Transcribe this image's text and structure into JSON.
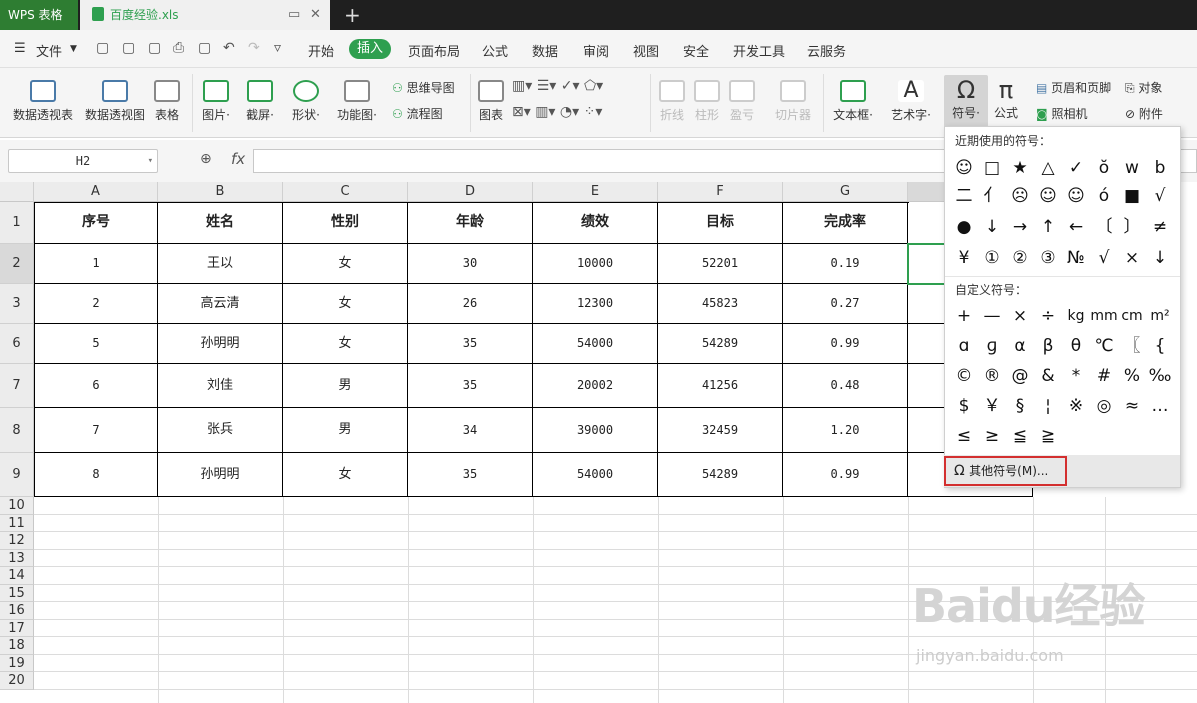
{
  "titlebar": {
    "app": "WPS 表格",
    "file": "百度经验.xls",
    "new_tab": "+"
  },
  "menu": {
    "quick": [
      "▢",
      "▢",
      "▢",
      "⎙",
      "▢",
      "↶",
      "↷",
      "▿"
    ],
    "items": [
      "开始",
      "插入",
      "页面布局",
      "公式",
      "数据",
      "审阅",
      "视图",
      "安全",
      "开发工具",
      "云服务"
    ],
    "file": "文件",
    "active": "插入"
  },
  "ribbon": {
    "big": [
      {
        "label": "数据透视表"
      },
      {
        "label": "数据透视图"
      },
      {
        "label": "表格"
      },
      {
        "label": "图片·"
      },
      {
        "label": "截屏·"
      },
      {
        "label": "形状·"
      },
      {
        "label": "功能图·"
      },
      {
        "label": "图表"
      },
      {
        "label": "折线"
      },
      {
        "label": "柱形"
      },
      {
        "label": "盈亏"
      },
      {
        "label": "切片器"
      },
      {
        "label": "文本框·"
      },
      {
        "label": "艺术字·"
      },
      {
        "label": "符号·"
      },
      {
        "label": "公式"
      }
    ],
    "small": [
      "思维导图",
      "流程图",
      "页眉和页脚",
      "照相机",
      "对象",
      "附件"
    ]
  },
  "formula": {
    "cell": "H2",
    "fx": "fx",
    "value": ""
  },
  "sheet": {
    "columns": [
      "A",
      "B",
      "C",
      "D",
      "E",
      "F",
      "G"
    ],
    "rows": [
      "1",
      "2",
      "3",
      "6",
      "7",
      "8",
      "9",
      "10",
      "11",
      "12",
      "13",
      "14",
      "15",
      "16",
      "17",
      "18",
      "19",
      "20"
    ],
    "header": [
      "序号",
      "姓名",
      "性别",
      "年龄",
      "绩效",
      "目标",
      "完成率"
    ],
    "data": [
      [
        "1",
        "王以",
        "女",
        "30",
        "10000",
        "52201",
        "0.19"
      ],
      [
        "2",
        "高云清",
        "女",
        "26",
        "12300",
        "45823",
        "0.27"
      ],
      [
        "5",
        "孙明明",
        "女",
        "35",
        "54000",
        "54289",
        "0.99"
      ],
      [
        "6",
        "刘佳",
        "男",
        "35",
        "20002",
        "41256",
        "0.48"
      ],
      [
        "7",
        "张兵",
        "男",
        "34",
        "39000",
        "32459",
        "1.20"
      ],
      [
        "8",
        "孙明明",
        "女",
        "35",
        "54000",
        "54289",
        "0.99"
      ]
    ]
  },
  "symbols": {
    "recent_title": "近期使用的符号：",
    "recent": [
      "☺",
      "□",
      "★",
      "△",
      "✓",
      "ŏ",
      "w",
      "b",
      "二",
      "亻",
      "☹",
      "☺",
      "☺",
      "ó",
      "■",
      "√",
      "●",
      "↓",
      "→",
      "↑",
      "←",
      "〔",
      "〕",
      "≠",
      "¥",
      "①",
      "②",
      "③",
      "№",
      "√",
      "×",
      "↓"
    ],
    "custom_title": "自定义符号：",
    "custom": [
      "+",
      "—",
      "×",
      "÷",
      "kg",
      "mm",
      "cm",
      "m²",
      "ɑ",
      "ɡ",
      "α",
      "β",
      "θ",
      "℃",
      "〖",
      "{",
      "©",
      "®",
      "@",
      "&",
      "*",
      "#",
      "%",
      "‰",
      "$",
      "￥",
      "§",
      "¦",
      "※",
      "◎",
      "≈",
      "…",
      "≤",
      "≥",
      "≦",
      "≧"
    ],
    "more": "其他符号(M)..."
  },
  "watermark": {
    "brand": "Baidu经验",
    "url": "jingyan.baidu.com"
  }
}
